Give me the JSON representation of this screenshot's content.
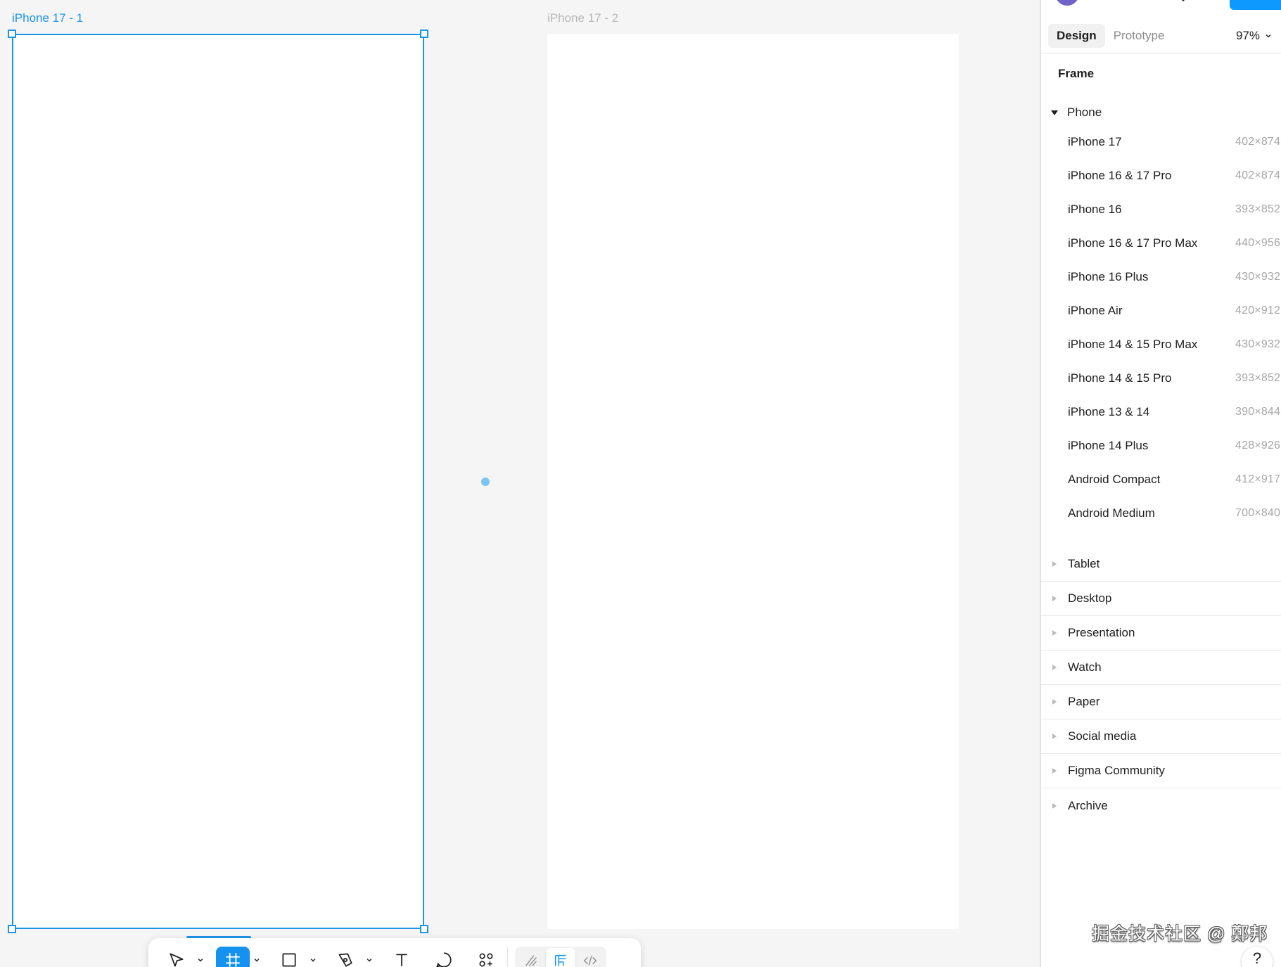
{
  "canvas": {
    "frames": [
      {
        "label": "iPhone 17 - 1",
        "selected": true
      },
      {
        "label": "iPhone 17 - 2",
        "selected": false
      }
    ]
  },
  "toolbar": {
    "tools": [
      {
        "icon": "move-icon",
        "active": false,
        "has_menu": true
      },
      {
        "icon": "frame-icon",
        "active": true,
        "has_menu": true
      },
      {
        "icon": "rectangle-icon",
        "active": false,
        "has_menu": true
      },
      {
        "icon": "pen-icon",
        "active": false,
        "has_menu": true
      },
      {
        "icon": "text-icon",
        "active": false,
        "has_menu": false
      },
      {
        "icon": "comment-icon",
        "active": false,
        "has_menu": false
      },
      {
        "icon": "actions-icon",
        "active": false,
        "has_menu": false
      }
    ],
    "modes": [
      {
        "icon": "draw-mode-icon",
        "active": false
      },
      {
        "icon": "design-mode-icon",
        "active": true
      },
      {
        "icon": "dev-mode-icon",
        "active": false
      }
    ],
    "accent_color": "#1592f0"
  },
  "panel": {
    "tabs": [
      {
        "label": "Design",
        "active": true
      },
      {
        "label": "Prototype",
        "active": false
      }
    ],
    "zoom": "97%",
    "section_title": "Frame",
    "expanded_group": {
      "label": "Phone",
      "presets": [
        {
          "name": "iPhone 17",
          "size": "402×874"
        },
        {
          "name": "iPhone 16 & 17 Pro",
          "size": "402×874"
        },
        {
          "name": "iPhone 16",
          "size": "393×852"
        },
        {
          "name": "iPhone 16 & 17 Pro Max",
          "size": "440×956"
        },
        {
          "name": "iPhone 16 Plus",
          "size": "430×932"
        },
        {
          "name": "iPhone Air",
          "size": "420×912"
        },
        {
          "name": "iPhone 14 & 15 Pro Max",
          "size": "430×932"
        },
        {
          "name": "iPhone 14 & 15 Pro",
          "size": "393×852"
        },
        {
          "name": "iPhone 13 & 14",
          "size": "390×844"
        },
        {
          "name": "iPhone 14 Plus",
          "size": "428×926"
        },
        {
          "name": "Android Compact",
          "size": "412×917"
        },
        {
          "name": "Android Medium",
          "size": "700×840"
        }
      ]
    },
    "collapsed_groups": [
      "Tablet",
      "Desktop",
      "Presentation",
      "Watch",
      "Paper",
      "Social media",
      "Figma Community",
      "Archive"
    ],
    "help_label": "?",
    "watermark": "掘金技术社区 @ 鄭邦",
    "selection_color": "#1d95e7"
  }
}
